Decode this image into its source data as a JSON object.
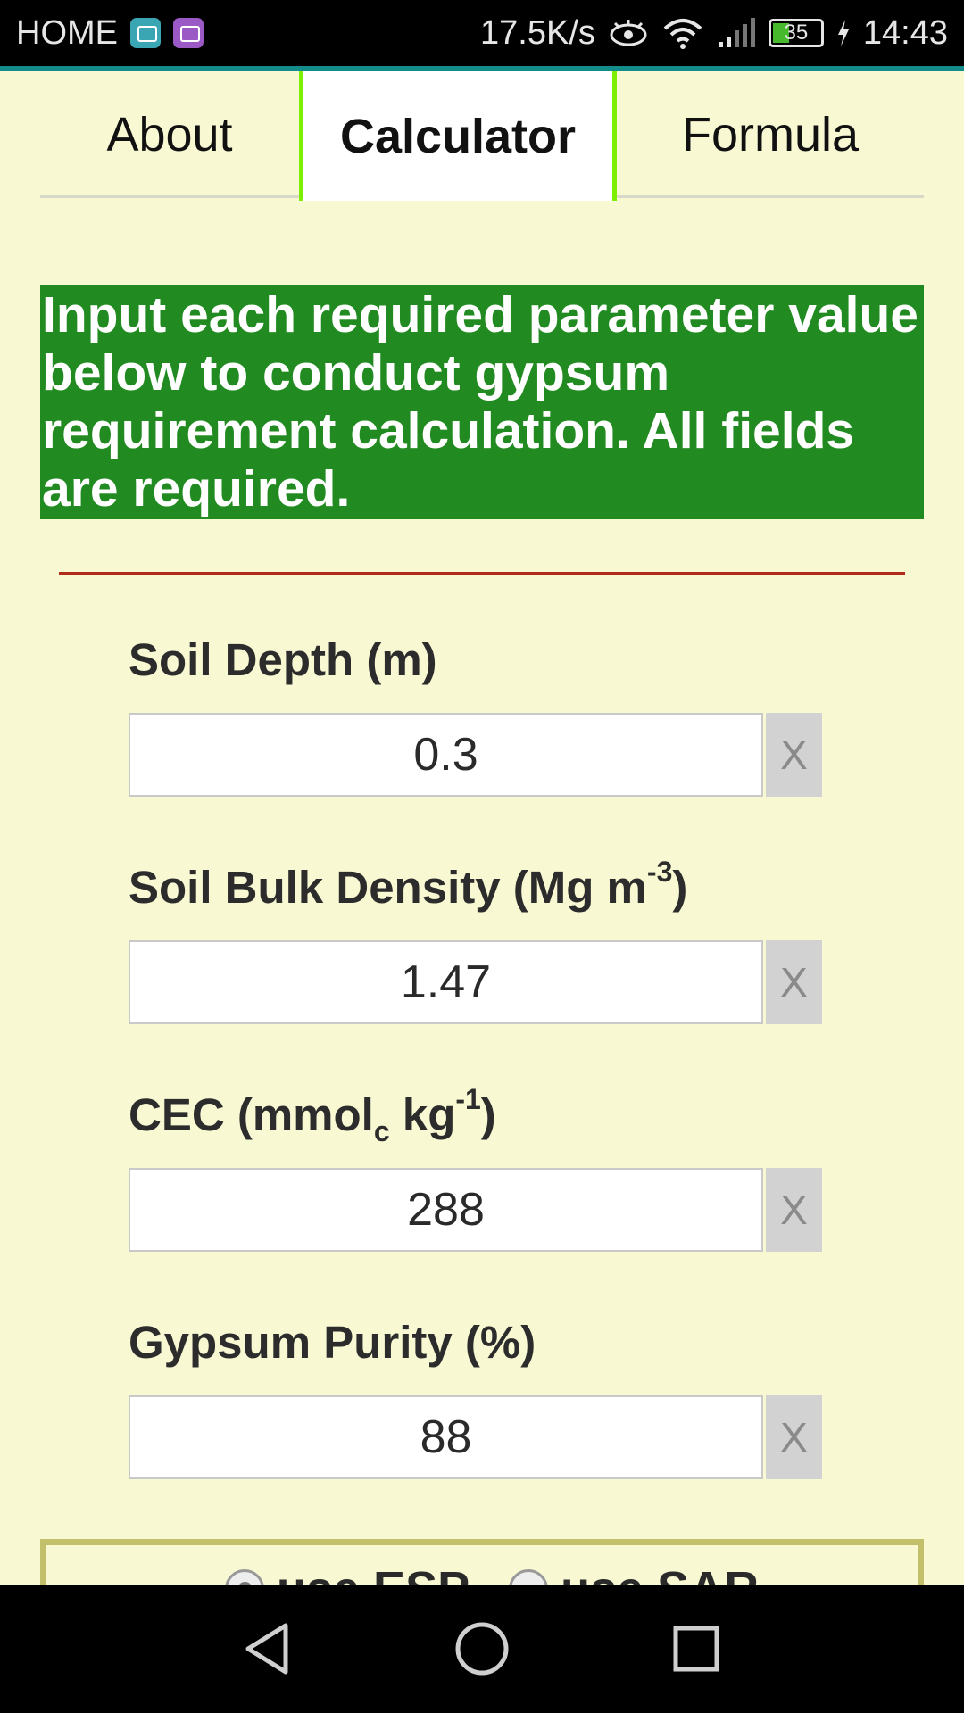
{
  "status_bar": {
    "carrier": "HOME",
    "net_speed": "17.5K/s",
    "battery": "35",
    "time": "14:43"
  },
  "tabs": [
    {
      "label": "About"
    },
    {
      "label": "Calculator"
    },
    {
      "label": "Formula"
    }
  ],
  "instructions": "Input each required parameter value below to conduct gypsum requirement calculation. All fields are required.",
  "fields": [
    {
      "label": "Soil Depth (m)",
      "value": "0.3",
      "clear": "X"
    },
    {
      "label_main": "Soil Bulk Density (Mg m",
      "label_sup": "-3",
      "label_end": ")",
      "value": "1.47",
      "clear": "X"
    },
    {
      "label_main": "CEC (mmol",
      "label_sub": "c",
      "label_mid": " kg",
      "label_sup": "-1",
      "label_end": ")",
      "value": "288",
      "clear": "X"
    },
    {
      "label": "Gypsum Purity (%)",
      "value": "88",
      "clear": "X"
    }
  ],
  "options": {
    "esp_label": "use ESP",
    "sar_label": "use SAR",
    "selected": "esp"
  },
  "colors": {
    "background": "#f8f8d3",
    "instruction_bg": "#218b21",
    "active_tab_border": "#7cf000",
    "divider": "#b22a1a"
  }
}
